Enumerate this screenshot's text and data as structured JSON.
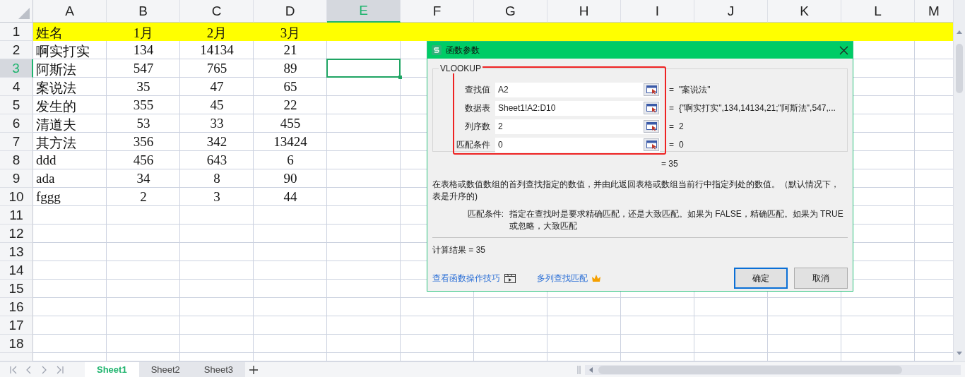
{
  "columns": [
    {
      "label": "A",
      "selected": false
    },
    {
      "label": "B",
      "selected": false
    },
    {
      "label": "C",
      "selected": false
    },
    {
      "label": "D",
      "selected": false
    },
    {
      "label": "E",
      "selected": true
    },
    {
      "label": "F",
      "selected": false
    },
    {
      "label": "G",
      "selected": false
    },
    {
      "label": "H",
      "selected": false
    },
    {
      "label": "I",
      "selected": false
    },
    {
      "label": "J",
      "selected": false
    },
    {
      "label": "K",
      "selected": false
    },
    {
      "label": "L",
      "selected": false
    },
    {
      "label": "M",
      "selected": false
    }
  ],
  "rows": [
    {
      "number": "1",
      "selected": false,
      "highlighted": true,
      "cells": [
        "姓名",
        "1月",
        "2月",
        "3月"
      ]
    },
    {
      "number": "2",
      "selected": false,
      "highlighted": false,
      "cells": [
        "啊实打实",
        "134",
        "14134",
        "21"
      ]
    },
    {
      "number": "3",
      "selected": true,
      "highlighted": false,
      "cells": [
        "阿斯法",
        "547",
        "765",
        "89"
      ]
    },
    {
      "number": "4",
      "selected": false,
      "highlighted": false,
      "cells": [
        "案说法",
        "35",
        "47",
        "65"
      ]
    },
    {
      "number": "5",
      "selected": false,
      "highlighted": false,
      "cells": [
        "发生的",
        "355",
        "45",
        "22"
      ]
    },
    {
      "number": "6",
      "selected": false,
      "highlighted": false,
      "cells": [
        "清道夫",
        "53",
        "33",
        "455"
      ]
    },
    {
      "number": "7",
      "selected": false,
      "highlighted": false,
      "cells": [
        "其方法",
        "356",
        "342",
        "13424"
      ]
    },
    {
      "number": "8",
      "selected": false,
      "highlighted": false,
      "cells": [
        "ddd",
        "456",
        "643",
        "6"
      ]
    },
    {
      "number": "9",
      "selected": false,
      "highlighted": false,
      "cells": [
        "ada",
        "34",
        "8",
        "90"
      ]
    },
    {
      "number": "10",
      "selected": false,
      "highlighted": false,
      "cells": [
        "fggg",
        "2",
        "3",
        "44"
      ]
    },
    {
      "number": "11",
      "selected": false,
      "highlighted": false
    },
    {
      "number": "12",
      "selected": false,
      "highlighted": false
    },
    {
      "number": "13",
      "selected": false,
      "highlighted": false
    },
    {
      "number": "14",
      "selected": false,
      "highlighted": false
    },
    {
      "number": "15",
      "selected": false,
      "highlighted": false
    },
    {
      "number": "16",
      "selected": false,
      "highlighted": false
    },
    {
      "number": "17",
      "selected": false,
      "highlighted": false
    },
    {
      "number": "18",
      "selected": false,
      "highlighted": false
    }
  ],
  "dialog": {
    "title": "函数参数",
    "function_name": "VLOOKUP",
    "arguments": [
      {
        "label": "查找值",
        "value": "A2",
        "sign": "=",
        "result": "\"案说法\""
      },
      {
        "label": "数据表",
        "value": "Sheet1!A2:D10",
        "sign": "=",
        "result": "{\"啊实打实\",134,14134,21;\"阿斯法\",547,..."
      },
      {
        "label": "列序数",
        "value": "2",
        "sign": "=",
        "result": "2"
      },
      {
        "label": "匹配条件",
        "value": "0",
        "sign": "=",
        "result": "0"
      }
    ],
    "formula_result": "= 35",
    "description": "在表格或数值数组的首列查找指定的数值，并由此返回表格或数组当前行中指定列处的数值。（默认情况下，表是升序的)",
    "argument_help": {
      "label": "匹配条件:",
      "text": "指定在查找时是要求精确匹配，还是大致匹配。如果为 FALSE，精确匹配。如果为 TRUE 或忽略，大致匹配"
    },
    "calc_result": "计算结果 = 35",
    "links": [
      {
        "label": "查看函数操作技巧",
        "kind": "video"
      },
      {
        "label": "多列查找匹配",
        "kind": "premium"
      }
    ],
    "buttons": [
      {
        "label": "确定",
        "default": true
      },
      {
        "label": "取消",
        "default": false
      }
    ]
  },
  "sheet_tabs": [
    {
      "label": "Sheet1",
      "selected": true
    },
    {
      "label": "Sheet2",
      "selected": false
    },
    {
      "label": "Sheet3",
      "selected": false
    }
  ]
}
